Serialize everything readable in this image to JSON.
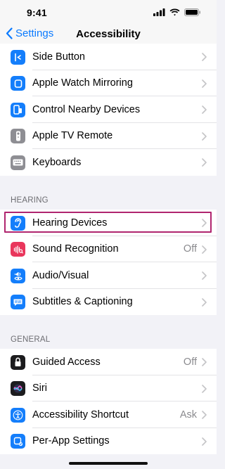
{
  "status_bar": {
    "time": "9:41"
  },
  "nav": {
    "back_label": "Settings",
    "title": "Accessibility"
  },
  "groups": {
    "top": [
      {
        "label": "Side Button",
        "value": ""
      },
      {
        "label": "Apple Watch Mirroring",
        "value": ""
      },
      {
        "label": "Control Nearby Devices",
        "value": ""
      },
      {
        "label": "Apple TV Remote",
        "value": ""
      },
      {
        "label": "Keyboards",
        "value": ""
      }
    ],
    "hearing": {
      "header": "HEARING",
      "items": [
        {
          "label": "Hearing Devices",
          "value": ""
        },
        {
          "label": "Sound Recognition",
          "value": "Off"
        },
        {
          "label": "Audio/Visual",
          "value": ""
        },
        {
          "label": "Subtitles & Captioning",
          "value": ""
        }
      ]
    },
    "general": {
      "header": "GENERAL",
      "items": [
        {
          "label": "Guided Access",
          "value": "Off"
        },
        {
          "label": "Siri",
          "value": ""
        },
        {
          "label": "Accessibility Shortcut",
          "value": "Ask"
        },
        {
          "label": "Per-App Settings",
          "value": ""
        }
      ]
    }
  },
  "colors": {
    "accent": "#0a7aff",
    "highlight": "#b0256f",
    "icon_blue": "#147efb",
    "icon_gray": "#8e8e93",
    "icon_pink": "#e9365c",
    "icon_black": "#1c1c1e"
  }
}
